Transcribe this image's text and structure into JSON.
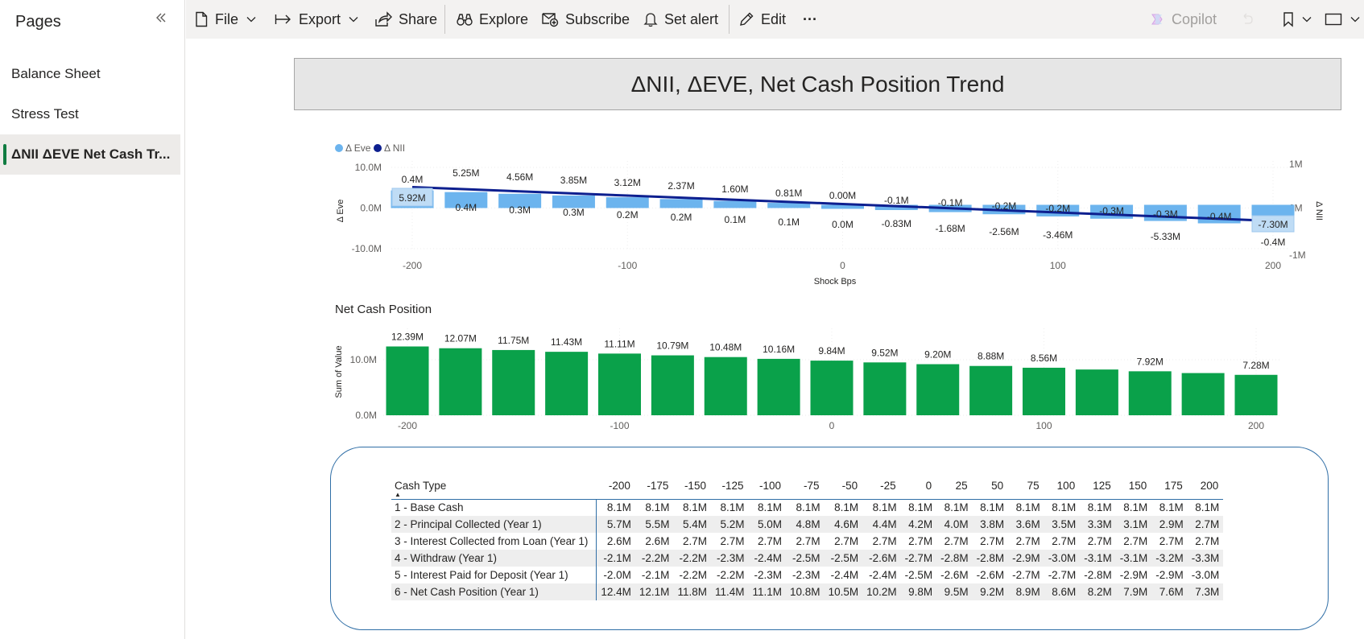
{
  "sidebar": {
    "title": "Pages",
    "items": [
      {
        "label": "Balance Sheet"
      },
      {
        "label": "Stress Test"
      },
      {
        "label": "ΔNII ΔEVE Net Cash Tr..."
      }
    ]
  },
  "toolbar": {
    "file": "File",
    "export": "Export",
    "share": "Share",
    "explore": "Explore",
    "subscribe": "Subscribe",
    "set_alert": "Set alert",
    "edit": "Edit",
    "more": "···",
    "copilot": "Copilot"
  },
  "report": {
    "title": "ΔNII, ΔEVE, Net Cash Position Trend"
  },
  "colors": {
    "eve_bar": "#6cb4ee",
    "eve_label_bg": "#bfdcf5",
    "nii_line": "#0d1f8f",
    "net_cash_bar": "#0aa14a",
    "table_border": "#2f6ea6"
  },
  "chart_data": [
    {
      "type": "bar+line",
      "legend": [
        "Δ Eve",
        "Δ NII"
      ],
      "legend_position": "top-left",
      "xlabel": "Shock Bps",
      "ylabel_left": "Δ Eve",
      "ylabel_right": "Δ NII",
      "x": [
        -200,
        -175,
        -150,
        -125,
        -100,
        -75,
        -50,
        -25,
        0,
        25,
        50,
        75,
        100,
        125,
        150,
        175,
        200
      ],
      "x_ticks": [
        "-200",
        "-100",
        "0",
        "100",
        "200"
      ],
      "y_left_ticks": [
        "10.0M",
        "0.0M",
        "-10.0M"
      ],
      "y_left_lim": [
        -10,
        10
      ],
      "y_right_ticks": [
        "1M",
        "0M",
        "-1M"
      ],
      "y_right_lim": [
        -1,
        1
      ],
      "series": [
        {
          "name": "Δ Eve",
          "axis": "left",
          "values": [
            5.92,
            5.25,
            4.56,
            3.85,
            3.12,
            2.37,
            1.6,
            0.81,
            0.0,
            -0.83,
            -1.68,
            -2.56,
            -3.46,
            -4.4,
            -5.33,
            -6.3,
            -7.3
          ],
          "labels": [
            "5.92M",
            "5.25M",
            "4.56M",
            "3.85M",
            "3.12M",
            "2.37M",
            "1.60M",
            "0.81M",
            "0.00M",
            "-0.83M",
            "-1.68M",
            "-2.56M",
            "-3.46M",
            "",
            "-5.33M",
            "",
            "-7.30M"
          ]
        },
        {
          "name": "Δ NII",
          "axis": "right",
          "values": [
            0.4,
            0.4,
            0.3,
            0.3,
            0.2,
            0.2,
            0.1,
            0.1,
            0.0,
            -0.1,
            -0.1,
            -0.2,
            -0.2,
            -0.3,
            -0.3,
            -0.4,
            -0.4
          ],
          "labels_above": [
            "0.4M",
            "",
            "",
            "",
            "",
            "",
            "",
            "",
            "",
            "-0.1M",
            "-0.1M",
            "-0.2M",
            "-0.2M",
            "-0.3M",
            "-0.3M",
            "-0.4M",
            ""
          ],
          "labels_below": [
            "",
            "0.4M",
            "0.3M",
            "0.3M",
            "0.2M",
            "0.2M",
            "0.1M",
            "0.1M",
            "0.0M",
            "",
            "",
            "",
            "",
            "",
            "",
            "",
            "-0.4M"
          ]
        }
      ]
    },
    {
      "type": "bar",
      "title": "Net Cash Position",
      "ylabel": "Sum of Value",
      "y_ticks": [
        "10.0M",
        "0.0M"
      ],
      "ylim": [
        0,
        13
      ],
      "x": [
        -200,
        -175,
        -150,
        -125,
        -100,
        -75,
        -50,
        -25,
        0,
        25,
        50,
        75,
        100,
        125,
        150,
        175,
        200
      ],
      "x_ticks": [
        "-200",
        "-100",
        "0",
        "100",
        "200"
      ],
      "values": [
        12.39,
        12.07,
        11.75,
        11.43,
        11.11,
        10.79,
        10.48,
        10.16,
        9.84,
        9.52,
        9.2,
        8.88,
        8.56,
        8.24,
        7.92,
        7.6,
        7.28
      ],
      "labels": [
        "12.39M",
        "12.07M",
        "11.75M",
        "11.43M",
        "11.11M",
        "10.79M",
        "10.48M",
        "10.16M",
        "9.84M",
        "9.52M",
        "9.20M",
        "8.88M",
        "8.56M",
        "",
        "7.92M",
        "",
        "7.28M"
      ]
    },
    {
      "type": "table",
      "row_header": "Cash Type",
      "columns": [
        "-200",
        "-175",
        "-150",
        "-125",
        "-100",
        "-75",
        "-50",
        "-25",
        "0",
        "25",
        "50",
        "75",
        "100",
        "125",
        "150",
        "175",
        "200"
      ],
      "rows": [
        {
          "label": "1 - Base Cash",
          "values": [
            "8.1M",
            "8.1M",
            "8.1M",
            "8.1M",
            "8.1M",
            "8.1M",
            "8.1M",
            "8.1M",
            "8.1M",
            "8.1M",
            "8.1M",
            "8.1M",
            "8.1M",
            "8.1M",
            "8.1M",
            "8.1M",
            "8.1M"
          ]
        },
        {
          "label": "2 - Principal Collected (Year 1)",
          "values": [
            "5.7M",
            "5.5M",
            "5.4M",
            "5.2M",
            "5.0M",
            "4.8M",
            "4.6M",
            "4.4M",
            "4.2M",
            "4.0M",
            "3.8M",
            "3.6M",
            "3.5M",
            "3.3M",
            "3.1M",
            "2.9M",
            "2.7M"
          ]
        },
        {
          "label": "3 - Interest Collected from Loan (Year 1)",
          "values": [
            "2.6M",
            "2.6M",
            "2.7M",
            "2.7M",
            "2.7M",
            "2.7M",
            "2.7M",
            "2.7M",
            "2.7M",
            "2.7M",
            "2.7M",
            "2.7M",
            "2.7M",
            "2.7M",
            "2.7M",
            "2.7M",
            "2.7M"
          ]
        },
        {
          "label": "4 - Withdraw (Year 1)",
          "values": [
            "-2.1M",
            "-2.2M",
            "-2.2M",
            "-2.3M",
            "-2.4M",
            "-2.5M",
            "-2.5M",
            "-2.6M",
            "-2.7M",
            "-2.8M",
            "-2.8M",
            "-2.9M",
            "-3.0M",
            "-3.1M",
            "-3.1M",
            "-3.2M",
            "-3.3M"
          ]
        },
        {
          "label": "5 - Interest Paid for Deposit (Year 1)",
          "values": [
            "-2.0M",
            "-2.1M",
            "-2.2M",
            "-2.2M",
            "-2.3M",
            "-2.3M",
            "-2.4M",
            "-2.4M",
            "-2.5M",
            "-2.6M",
            "-2.6M",
            "-2.7M",
            "-2.7M",
            "-2.8M",
            "-2.9M",
            "-2.9M",
            "-3.0M"
          ]
        },
        {
          "label": "6 - Net Cash Position (Year 1)",
          "values": [
            "12.4M",
            "12.1M",
            "11.8M",
            "11.4M",
            "11.1M",
            "10.8M",
            "10.5M",
            "10.2M",
            "9.8M",
            "9.5M",
            "9.2M",
            "8.9M",
            "8.6M",
            "8.2M",
            "7.9M",
            "7.6M",
            "7.3M"
          ]
        }
      ]
    }
  ]
}
